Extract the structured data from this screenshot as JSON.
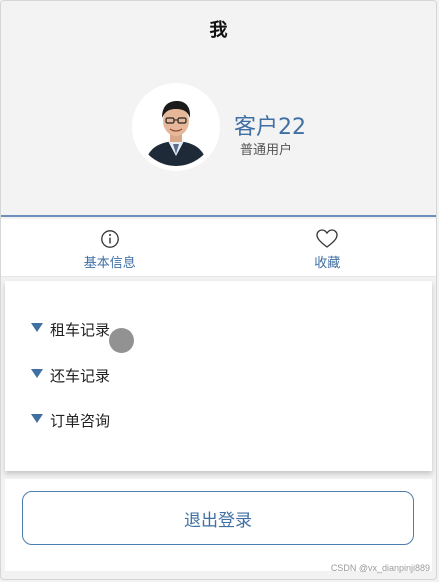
{
  "header": {
    "title": "我"
  },
  "profile": {
    "name": "客户22",
    "user_type": "普通用户",
    "avatar_icon": "user-photo-avatar"
  },
  "tabs": [
    {
      "label": "基本信息",
      "icon": "info-circle-icon"
    },
    {
      "label": "收藏",
      "icon": "heart-icon"
    }
  ],
  "menu": {
    "items": [
      {
        "label": "租车记录",
        "icon": "triangle-down-icon"
      },
      {
        "label": "还车记录",
        "icon": "triangle-down-icon"
      },
      {
        "label": "订单咨询",
        "icon": "triangle-down-icon"
      }
    ]
  },
  "logout": {
    "label": "退出登录"
  },
  "watermark": "CSDN @vx_dianpinji889",
  "colors": {
    "accent": "#3f6fa3",
    "divider": "#6d8fbe",
    "background": "#f2f2f2"
  }
}
